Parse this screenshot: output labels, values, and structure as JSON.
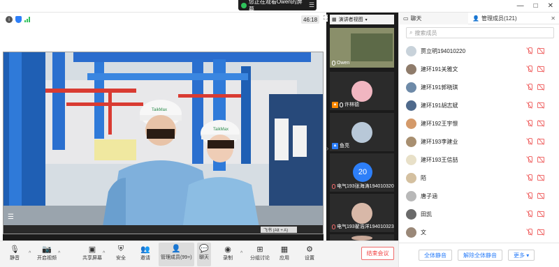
{
  "topbar": {
    "share_notice": "您正在观看Owen的屏幕",
    "share_menu_icon": "menu-icon",
    "window_controls": [
      "—",
      "□",
      "✕"
    ]
  },
  "video": {
    "timer": "46:18",
    "presenter_view_label": "演讲者视图",
    "screen_watermark": "飞书 (Alt + A)",
    "scene_text_helmet": "TaikMax"
  },
  "tiles": [
    {
      "name": "Owen",
      "badge": ""
    },
    {
      "name": "许林德",
      "badge": "orange"
    },
    {
      "name": "鱼亮",
      "badge": "blue"
    },
    {
      "name": "电气193张海涛194010320",
      "avatar_text": "20"
    },
    {
      "name": "电气193翟浩洋194010323"
    },
    {
      "name": ""
    }
  ],
  "panel": {
    "chat_tab": "聊天",
    "members_tab": "管理成员(121)",
    "search_placeholder": "搜索成员",
    "mute_all": "全体静音",
    "unmute_all": "解除全体静音",
    "more": "更多 ▾",
    "members": [
      {
        "name": "贾立明194010220",
        "color": "#c8d2da"
      },
      {
        "name": "建环191关雅文",
        "color": "#8f7c6b"
      },
      {
        "name": "建环191郭晓琪",
        "color": "#6e8aa8"
      },
      {
        "name": "建环191胡志斌",
        "color": "#4f6a8c"
      },
      {
        "name": "建环192王宇憬",
        "color": "#d49a6a"
      },
      {
        "name": "建环193李建业",
        "color": "#a88f70"
      },
      {
        "name": "建环193王信喆",
        "color": "#e8e0c8"
      },
      {
        "name": "陌",
        "color": "#d4c0a0"
      },
      {
        "name": "唐子涵",
        "color": "#b8b8b8"
      },
      {
        "name": "田凯",
        "color": "#6a6a6a"
      },
      {
        "name": "文",
        "color": "#9a8878"
      }
    ]
  },
  "toolbar": {
    "mute": "静音",
    "start_video": "开启视频",
    "share_screen": "共享屏幕",
    "security": "安全",
    "invite": "邀请",
    "manage_members": "管理成员(99+)",
    "chat": "聊天",
    "record": "录制",
    "breakout": "分组讨论",
    "apps": "应用",
    "settings": "设置",
    "end_meeting": "结束会议"
  },
  "colors": {
    "accent": "#2d7ff9",
    "danger": "#f03e3e",
    "share_dot": "#2fc25b"
  }
}
